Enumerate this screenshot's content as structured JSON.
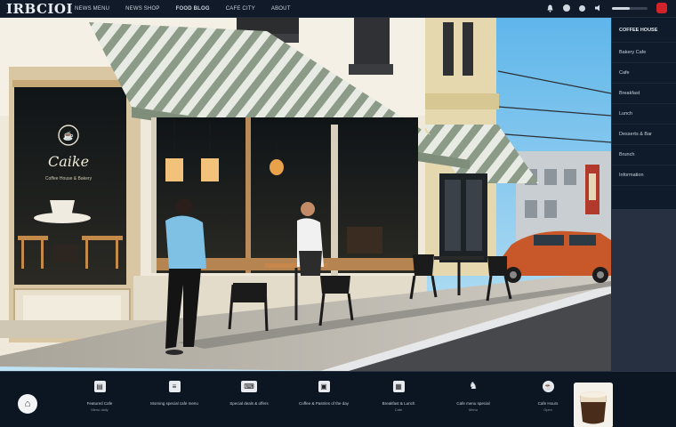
{
  "app": {
    "logo_text": "IRBCIOI"
  },
  "top_nav": {
    "items": [
      {
        "label": "NEWS  MENU"
      },
      {
        "label": "NEWS  SHOP"
      },
      {
        "label": "FOOD  BLOG"
      },
      {
        "label": "CAFE  CITY"
      },
      {
        "label": "ABOUT"
      }
    ]
  },
  "top_controls": {
    "volume_level": 0.5
  },
  "scene": {
    "cafe_sign": "Caike",
    "shopfront_caption": "Coffee House & Bakery"
  },
  "sidebar": {
    "items": [
      {
        "label": "COFFEE HOUSE"
      },
      {
        "label": "Bakery Cafe"
      },
      {
        "label": "Cafe"
      },
      {
        "label": "Breakfast"
      },
      {
        "label": "Lunch"
      },
      {
        "label": "Desserts & Bar"
      },
      {
        "label": "Brunch"
      },
      {
        "label": "Information"
      }
    ]
  },
  "dock": {
    "items": [
      {
        "label": "Featured Cafe",
        "sub": "Menu  daily",
        "icon": "document-icon"
      },
      {
        "label": "Morning special cafe menu",
        "sub": "",
        "icon": "receipt-icon"
      },
      {
        "label": "Special deals & offers",
        "sub": "",
        "icon": "keyboard-icon"
      },
      {
        "label": "Coffee & Pastries of the day",
        "sub": "",
        "icon": "briefcase-icon"
      },
      {
        "label": "Breakfast & Lunch",
        "sub": "Cafe",
        "icon": "calendar-icon"
      },
      {
        "label": "Cafe menu special",
        "sub": "Menu",
        "icon": "person-icon"
      },
      {
        "label": "Cafe Hours",
        "sub": "Open",
        "icon": "coffee-icon"
      }
    ]
  },
  "colors": {
    "awning_stripe_light": "#e8ebe4",
    "awning_stripe_dark": "#8c9a88",
    "car": "#c8582a",
    "alert": "#d3232a"
  }
}
